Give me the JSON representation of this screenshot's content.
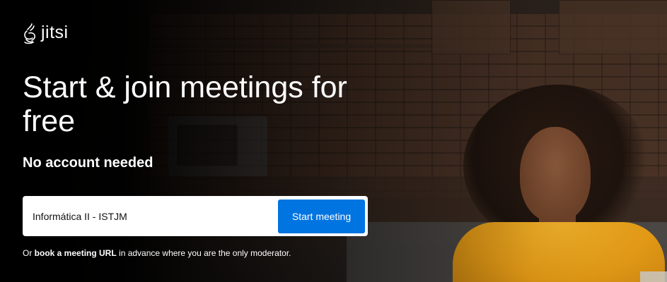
{
  "brand": {
    "name": "jitsi",
    "icon": "jitsi-logo-icon"
  },
  "hero": {
    "title": "Start & join meetings for free",
    "subtitle": "No account needed"
  },
  "meeting_form": {
    "room_name_value": "Informática II - ISTJM",
    "start_button_label": "Start meeting",
    "accent_color": "#0074e0"
  },
  "footer_note": {
    "prefix": "Or ",
    "link_text": "book a meeting URL",
    "suffix": " in advance where you are the only moderator."
  }
}
